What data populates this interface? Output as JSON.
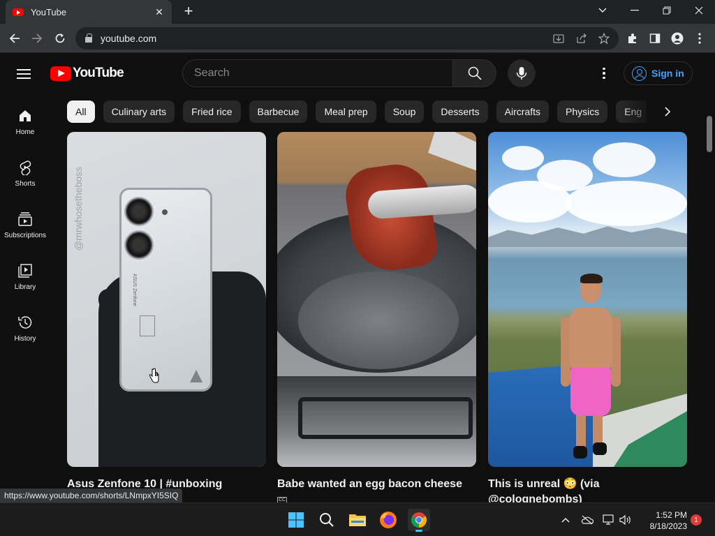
{
  "browser": {
    "tab_title": "YouTube",
    "new_tab_glyph": "+",
    "url": "youtube.com",
    "window_controls": [
      "chevron-down-icon",
      "minimize-icon",
      "restore-icon",
      "close-icon"
    ],
    "status_link": "https://www.youtube.com/shorts/LNmpxYI5SIQ"
  },
  "youtube": {
    "logo_text": "YouTube",
    "search_placeholder": "Search",
    "signin_label": "Sign in",
    "accent_color": "#ff0000",
    "link_color": "#3ea6ff"
  },
  "sidebar": {
    "items": [
      {
        "label": "Home",
        "icon": "home-icon"
      },
      {
        "label": "Shorts",
        "icon": "shorts-icon"
      },
      {
        "label": "Subscriptions",
        "icon": "subscriptions-icon"
      },
      {
        "label": "Library",
        "icon": "library-icon"
      },
      {
        "label": "History",
        "icon": "history-icon"
      }
    ]
  },
  "chips": [
    "All",
    "Culinary arts",
    "Fried rice",
    "Barbecue",
    "Meal prep",
    "Soup",
    "Desserts",
    "Aircrafts",
    "Physics",
    "Eng"
  ],
  "shorts": [
    {
      "title": "Asus Zenfone 10 | #unboxing",
      "thumb_watermark": "@mrwhosetheboss",
      "phone_brand": "ASUS Zenfone"
    },
    {
      "title": "Babe wanted an egg bacon cheese",
      "badge": "CC"
    },
    {
      "title": "This is unreal 😳 (via @colognebombs)"
    }
  ],
  "taskbar": {
    "time": "1:52 PM",
    "date": "8/18/2023",
    "notification_count": "1"
  }
}
